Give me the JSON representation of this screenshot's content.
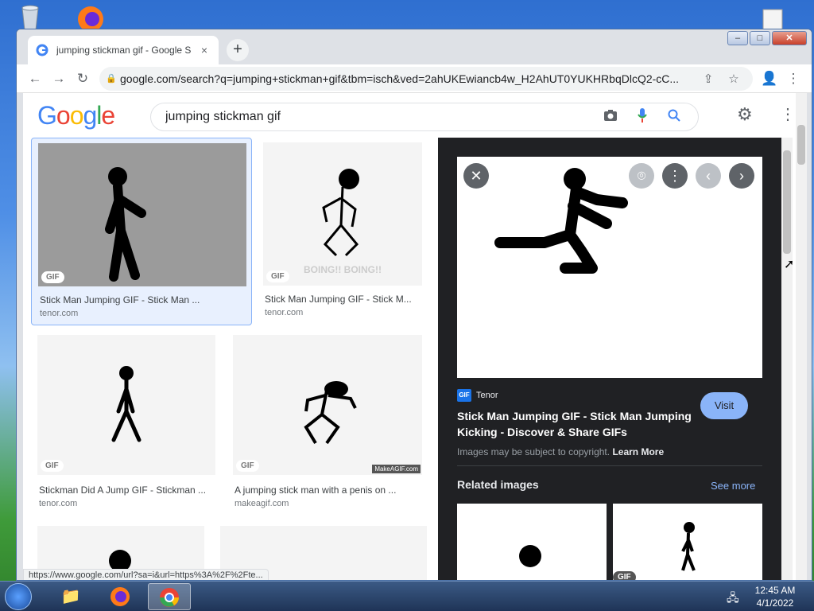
{
  "browser": {
    "tab_title": "jumping stickman gif - Google S",
    "tab_close": "×",
    "new_tab": "+",
    "url": "google.com/search?q=jumping+stickman+gif&tbm=isch&ved=2ahUKEwiancb4w_H2AhUT0YUKHRbqDlcQ2-cC...",
    "window_controls": {
      "minimize": "–",
      "maximize": "□",
      "close": "✕"
    },
    "nav": {
      "back": "←",
      "forward": "→",
      "reload": "↻",
      "share": "⇪",
      "bookmark": "☆",
      "profile": "👤",
      "menu": "⋮"
    },
    "status_url": "https://www.google.com/url?sa=i&url=https%3A%2F%2Fte..."
  },
  "google": {
    "logo": [
      "G",
      "o",
      "o",
      "g",
      "l",
      "e"
    ],
    "logo_colors": [
      "#4285F4",
      "#EA4335",
      "#FBBC05",
      "#4285F4",
      "#34A853",
      "#EA4335"
    ],
    "query": "jumping stickman gif",
    "icons": {
      "camera": "camera-icon",
      "mic": "mic-icon",
      "search": "search-icon",
      "settings": "gear-icon",
      "apps": "apps-icon"
    }
  },
  "results": [
    {
      "title": "Stick Man Jumping GIF - Stick Man ...",
      "source": "tenor.com",
      "badge": "GIF"
    },
    {
      "title": "Stick Man Jumping GIF - Stick M...",
      "source": "tenor.com",
      "badge": "GIF",
      "overlay": "BOING!! BOING!!"
    },
    {
      "title": "Stickman Did A Jump GIF - Stickman ...",
      "source": "tenor.com",
      "badge": "GIF"
    },
    {
      "title": "A jumping stick man with a penis on ...",
      "source": "makeagif.com",
      "badge": "GIF",
      "watermark": "MakeAGIF.com"
    }
  ],
  "preview": {
    "source_name": "Tenor",
    "source_logo": "GIF",
    "title": "Stick Man Jumping GIF - Stick Man Jumping Kicking - Discover & Share GIFs",
    "visit_label": "Visit",
    "copyright_text": "Images may be subject to copyright.",
    "learn_more": "Learn More",
    "related_title": "Related images",
    "see_more": "See more",
    "related_badge": "GIF"
  },
  "taskbar": {
    "time": "12:45 AM",
    "date": "4/1/2022"
  }
}
